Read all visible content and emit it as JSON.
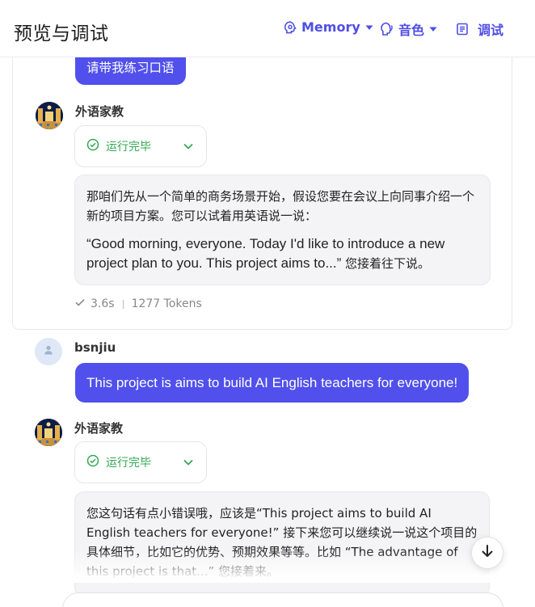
{
  "header": {
    "title": "预览与调试",
    "memory_label": "Memory",
    "voice_label": "音色",
    "debug_label": "调试"
  },
  "conversation": {
    "first_user_message": "请带我练习口语",
    "bot_name": "外语家教",
    "status_label": "运行完毕",
    "reply1": {
      "line1": "那咱们先从一个简单的商务场景开始，假设您要在会议上向同事介绍一个新的项目方案。您可以试着用英语说一说：",
      "quote": "“Good morning, everyone. Today I'd like to introduce a new project plan to you. This project aims to...”",
      "tail": " 您接着往下说。"
    },
    "meta": {
      "duration": "3.6s",
      "tokens": "1277 Tokens"
    },
    "user_name": "bsnjiu",
    "second_user_message": "This project is aims to build AI English teachers for everyone!",
    "reply2": {
      "text": "您这句话有点小错误哦，应该是“This project aims to build AI English teachers for everyone!” 接下来您可以继续说一说这个项目的具体细节，比如它的优势、预期效果等等。比如 “The advantage of this project is that...” 您接着来。"
    }
  },
  "colors": {
    "accent": "#5150ec",
    "success": "#34a853"
  }
}
